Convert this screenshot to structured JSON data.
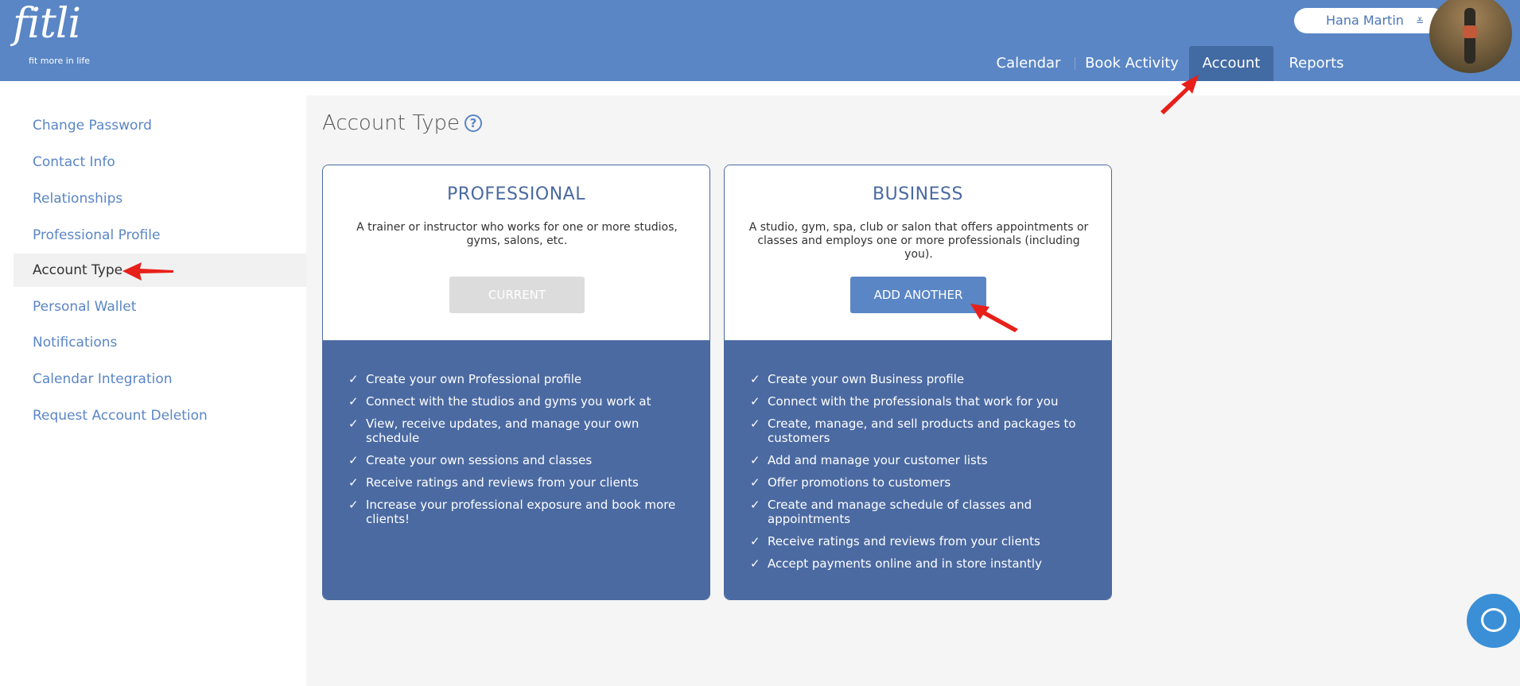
{
  "app": {
    "logo_text": "fitli",
    "logo_tagline": "fit more in life"
  },
  "header": {
    "user_name": "Hana Martin",
    "user_menu_chevron": "≚",
    "nav": [
      {
        "label": "Calendar"
      },
      {
        "label": "Book Activity"
      },
      {
        "label": "Account"
      },
      {
        "label": "Reports"
      }
    ],
    "active_nav": "Account"
  },
  "sidebar": {
    "items": [
      {
        "label": "Change Password"
      },
      {
        "label": "Contact Info"
      },
      {
        "label": "Relationships"
      },
      {
        "label": "Professional Profile"
      },
      {
        "label": "Account Type"
      },
      {
        "label": "Personal Wallet"
      },
      {
        "label": "Notifications"
      },
      {
        "label": "Calendar Integration"
      },
      {
        "label": "Request Account Deletion"
      }
    ],
    "active_item": "Account Type"
  },
  "main": {
    "title": "Account Type",
    "help_glyph": "?",
    "cards": [
      {
        "title": "PROFESSIONAL",
        "description": "A trainer or instructor who works for one or more studios, gyms, salons, etc.",
        "button_label": "CURRENT",
        "features": [
          "Create your own Professional profile",
          "Connect with the studios and gyms you work at",
          "View, receive updates, and manage your own schedule",
          "Create your own sessions and classes",
          "Receive ratings and reviews from your clients",
          "Increase your professional exposure and book more clients!"
        ]
      },
      {
        "title": "BUSINESS",
        "description": "A studio, gym, spa, club or salon that offers appointments or classes and employs one or more professionals (including you).",
        "button_label": "ADD ANOTHER",
        "features": [
          "Create your own Business profile",
          "Connect with the professionals that work for you",
          "Create, manage, and sell products and packages to customers",
          "Add and manage your customer lists",
          "Offer promotions to customers",
          "Create and manage schedule of classes and appointments",
          "Receive ratings and reviews from your clients",
          "Accept payments online and in store instantly"
        ]
      }
    ],
    "check_glyph": "✓"
  },
  "colors": {
    "header_bg": "#5a86c5",
    "active_tab": "#426aa3",
    "card_bottom": "#4b6aa2",
    "link": "#5a86c5",
    "annotation_arrow": "#e8201a"
  }
}
